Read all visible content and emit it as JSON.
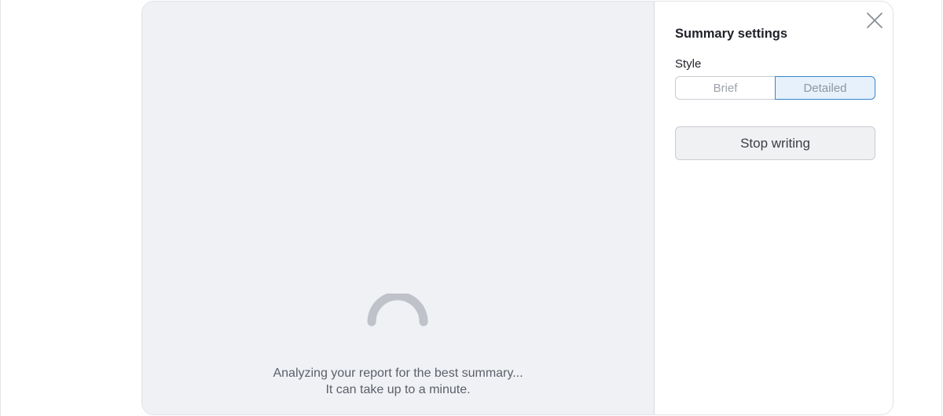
{
  "loading": {
    "line1": "Analyzing your report for the best summary...",
    "line2": "It can take up to a minute."
  },
  "settings": {
    "title": "Summary settings",
    "style_label": "Style",
    "style_options": [
      {
        "label": "Brief",
        "selected": false
      },
      {
        "label": "Detailed",
        "selected": true
      }
    ],
    "stop_label": "Stop writing",
    "close_icon": "close-icon"
  },
  "icons": {
    "spinner": "loading-spinner-icon",
    "close": "close-icon"
  },
  "colors": {
    "preview_background": "#f0f1f5",
    "selected_accent": "#3a86c8",
    "selected_fill": "#e6f1fb",
    "spinner": "#bfc2c9"
  }
}
